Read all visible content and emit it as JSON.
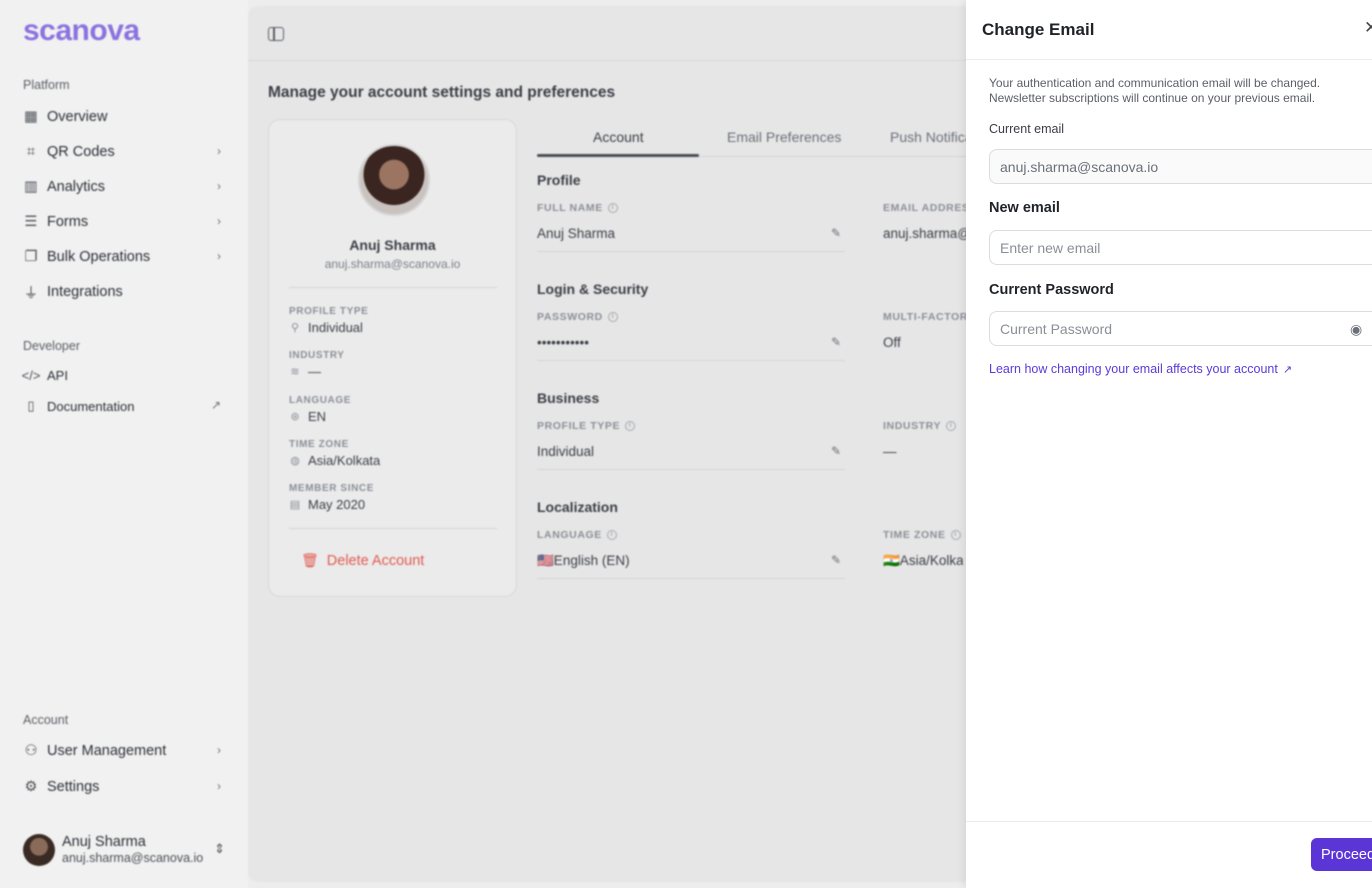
{
  "sidebar": {
    "logo": "scanova",
    "platform_label": "Platform",
    "platform_items": [
      {
        "label": "Overview",
        "icon": "grid-icon"
      },
      {
        "label": "QR Codes",
        "icon": "qr-icon"
      },
      {
        "label": "Analytics",
        "icon": "chart-icon"
      },
      {
        "label": "Forms",
        "icon": "form-icon"
      },
      {
        "label": "Bulk Operations",
        "icon": "stack-icon"
      },
      {
        "label": "Integrations",
        "icon": "plug-icon"
      }
    ],
    "developer_label": "Developer",
    "developer_items": [
      {
        "label": "API",
        "icon": "code-icon"
      },
      {
        "label": "Documentation",
        "icon": "book-icon"
      }
    ],
    "account_label": "Account",
    "account_items": [
      {
        "label": "User Management",
        "icon": "users-icon"
      },
      {
        "label": "Settings",
        "icon": "settings-icon"
      }
    ],
    "user": {
      "name": "Anuj Sharma",
      "email": "anuj.sharma@scanova.io"
    }
  },
  "main": {
    "page_title": "Manage your account settings and preferences",
    "profile_card": {
      "name": "Anuj Sharma",
      "email": "anuj.sharma@scanova.io",
      "fields": [
        {
          "label": "PROFILE TYPE",
          "value": "Individual"
        },
        {
          "label": "INDUSTRY",
          "value": "—"
        },
        {
          "label": "LANGUAGE",
          "value": "EN"
        },
        {
          "label": "TIME ZONE",
          "value": "Asia/Kolkata"
        },
        {
          "label": "MEMBER SINCE",
          "value": "May 2020"
        }
      ],
      "delete_label": "Delete Account"
    },
    "tabs": [
      "Account",
      "Email Preferences",
      "Push Notificat"
    ],
    "sections": {
      "profile": {
        "title": "Profile",
        "full_name_label": "FULL NAME",
        "full_name": "Anuj Sharma",
        "email_label": "EMAIL ADDRESS",
        "email": "anuj.sharma@"
      },
      "security": {
        "title": "Login & Security",
        "password_label": "PASSWORD",
        "password": "•••••••••••",
        "mfa_label": "MULTI-FACTOR",
        "mfa": "Off"
      },
      "business": {
        "title": "Business",
        "profile_type_label": "PROFILE TYPE",
        "profile_type": "Individual",
        "industry_label": "INDUSTRY",
        "industry": "—"
      },
      "localization": {
        "title": "Localization",
        "language_label": "LANGUAGE",
        "language": "🇺🇸English (EN)",
        "timezone_label": "TIME ZONE",
        "timezone": "🇮🇳Asia/Kolkat"
      }
    }
  },
  "drawer": {
    "title": "Change Email",
    "description": "Your authentication and communication email will be changed. Newsletter subscriptions will continue on your previous email.",
    "current_email_label": "Current email",
    "current_email_value": "anuj.sharma@scanova.io",
    "new_email_label": "New email",
    "new_email_placeholder": "Enter new email",
    "password_label": "Current Password",
    "password_placeholder": "Current Password",
    "learn_link": "Learn how changing your email affects your account",
    "proceed_label": "Proceed"
  },
  "colors": {
    "accent": "#5b35d5",
    "logo": "#8b72e0",
    "danger": "#e05a4e"
  }
}
